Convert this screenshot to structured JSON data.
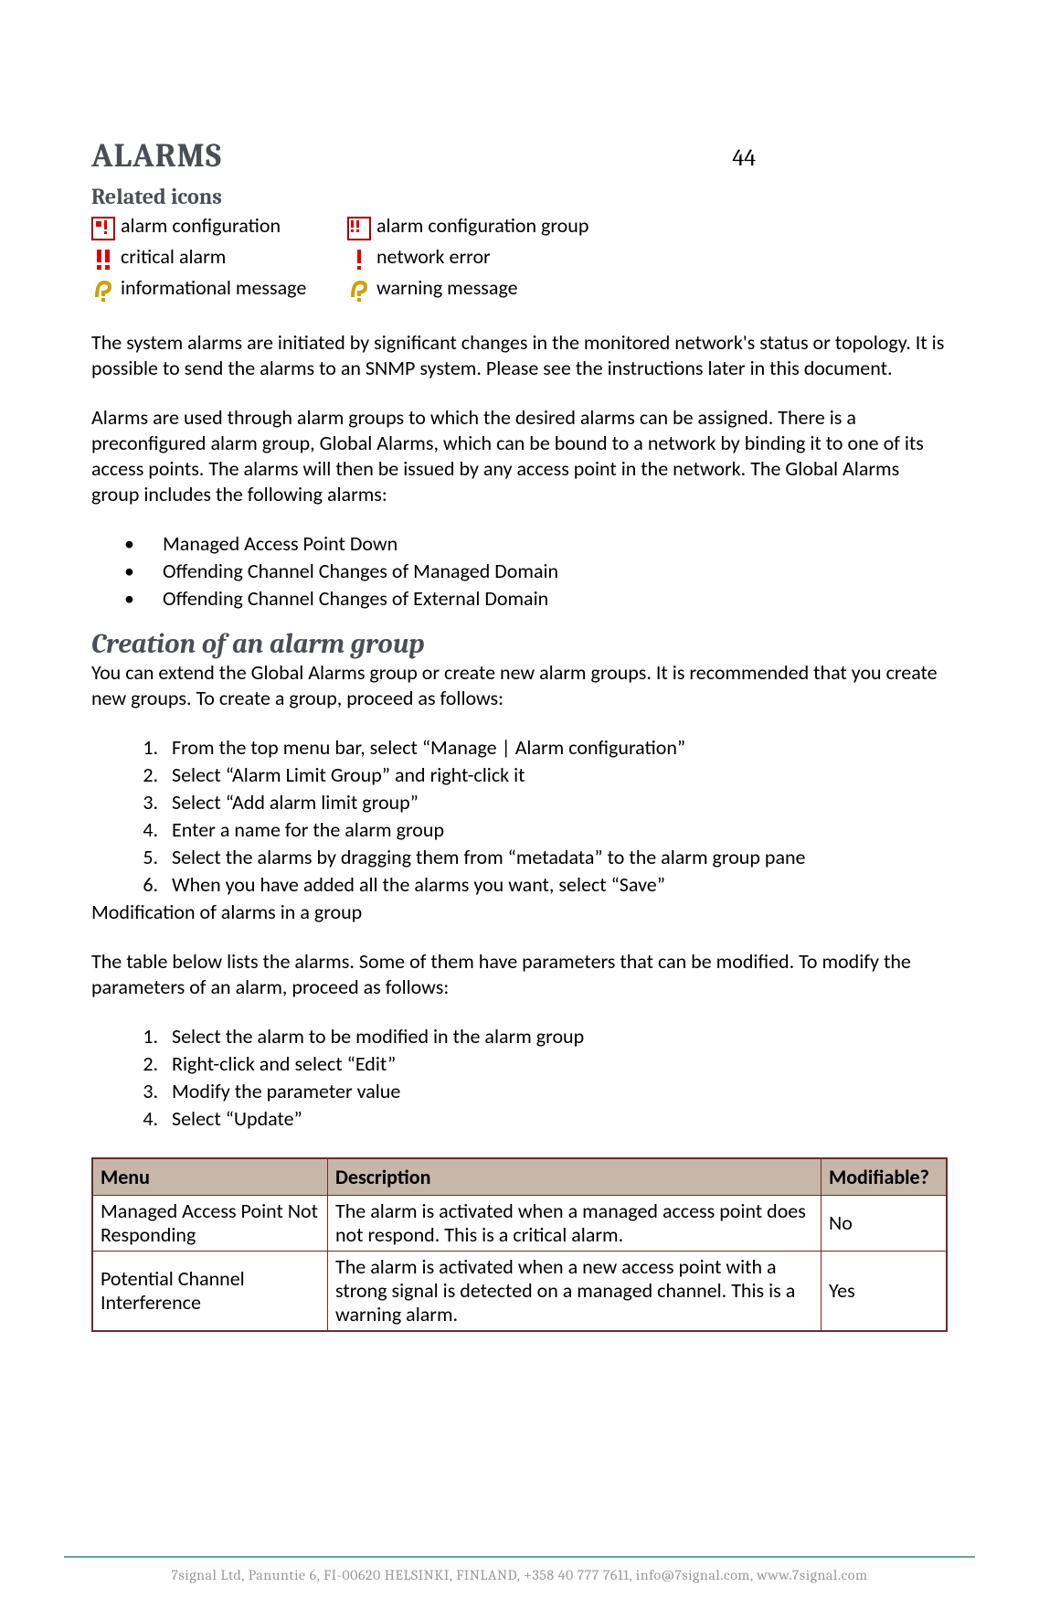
{
  "page_number": "44",
  "heading": "ALARMS",
  "related_icons_heading": "Related icons",
  "icons": {
    "alarm_config": "alarm configuration",
    "alarm_config_group": "alarm configuration group",
    "critical_alarm": "critical alarm",
    "network_error": "network error",
    "informational_message": "informational message",
    "warning_message": "warning message"
  },
  "para1": "The system alarms are initiated by significant changes in the monitored network's status or topology. It is possible to send the alarms to an SNMP system. Please see the instructions later in this document.",
  "para2": "Alarms are used through alarm groups to which the desired alarms can be assigned. There is a preconfigured alarm group, Global Alarms, which can be bound to a network by binding it to one of its access points. The alarms will then be issued by any access point in the network. The Global Alarms group includes the following alarms:",
  "bullets": [
    "Managed Access Point Down",
    "Offending Channel Changes of Managed Domain",
    "Offending Channel Changes of External Domain"
  ],
  "section_heading": "Creation of an alarm group",
  "para3": "You can extend the Global Alarms group or create new alarm groups. It is recommended that you create new groups. To create a group, proceed as follows:",
  "steps1": [
    "From the top menu bar, select “Manage | Alarm configuration”",
    "Select “Alarm Limit Group” and right-click it",
    "Select “Add alarm limit group”",
    "Enter a name for the alarm group",
    "Select the alarms by dragging them from “metadata” to the alarm group pane",
    "When you have added all the alarms you want, select “Save”"
  ],
  "para4": "Modification of alarms in a group",
  "para5": "The table below lists the alarms. Some of them have parameters that can be modified. To modify the parameters of an alarm, proceed as follows:",
  "steps2": [
    "Select the alarm to be modified in the alarm group",
    "Right-click and select “Edit”",
    "Modify the parameter value",
    "Select “Update”"
  ],
  "table": {
    "headers": {
      "menu": "Menu",
      "description": "Description",
      "modifiable": "Modifiable?"
    },
    "rows": [
      {
        "menu": "Managed Access Point Not Responding",
        "description": "The alarm is activated when a managed access point does not respond. This is a critical alarm.",
        "modifiable": "No"
      },
      {
        "menu": "Potential Channel Interference",
        "description": "The alarm is activated when a new access point with a strong signal is detected on a managed channel. This is a warning alarm.",
        "modifiable": "Yes"
      }
    ]
  },
  "footer": "7signal Ltd, Panuntie 6, FI-00620 HELSINKI, FINLAND, +358 40 777 7611, info@7signal.com, www.7signal.com"
}
